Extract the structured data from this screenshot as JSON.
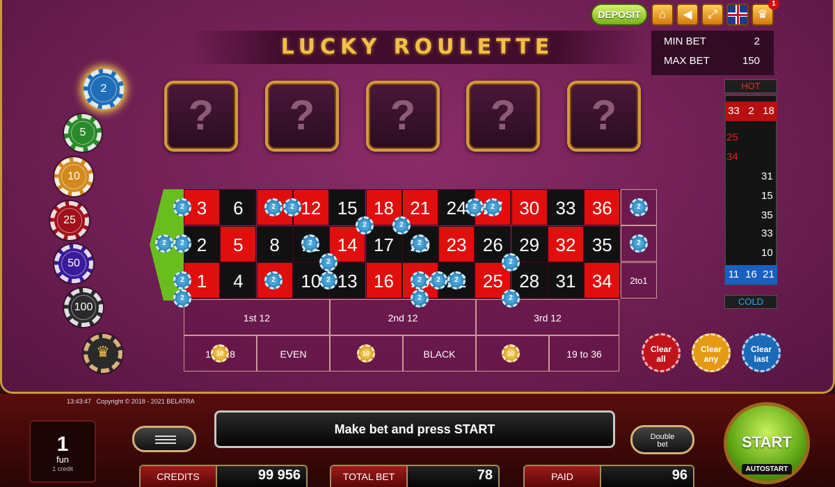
{
  "header": {
    "title": "LUCKY ROULETTE",
    "deposit_label": "DEPOSIT",
    "trophy_badge": "1",
    "icons": [
      "home-icon",
      "sound-icon",
      "fullscreen-icon",
      "uk-flag-icon",
      "trophy-icon"
    ]
  },
  "limits": {
    "min_label": "MIN BET",
    "min_value": "2",
    "max_label": "MAX BET",
    "max_value": "150"
  },
  "mystery_boxes": [
    "?",
    "?",
    "?",
    "?",
    "?"
  ],
  "chips": [
    {
      "value": "2",
      "color": "#1e6fb8",
      "selected": true
    },
    {
      "value": "5",
      "color": "#2a8a2a"
    },
    {
      "value": "10",
      "color": "#d28a1e"
    },
    {
      "value": "25",
      "color": "#a3101a"
    },
    {
      "value": "50",
      "color": "#3a1a9a"
    },
    {
      "value": "100",
      "color": "#2a2a2a"
    }
  ],
  "table": {
    "rows": [
      [
        "3",
        "6",
        "9",
        "12",
        "15",
        "18",
        "21",
        "24",
        "27",
        "30",
        "33",
        "36"
      ],
      [
        "2",
        "5",
        "8",
        "11",
        "14",
        "17",
        "20",
        "23",
        "26",
        "29",
        "32",
        "35"
      ],
      [
        "1",
        "4",
        "7",
        "10",
        "13",
        "16",
        "19",
        "22",
        "25",
        "28",
        "31",
        "34"
      ]
    ],
    "red_numbers": [
      1,
      3,
      5,
      7,
      9,
      12,
      14,
      16,
      18,
      19,
      21,
      23,
      25,
      27,
      30,
      32,
      34,
      36
    ],
    "column_bet_label": "2to1",
    "dozens": [
      "1st 12",
      "2nd 12",
      "3rd 12"
    ],
    "outside": [
      "1 to 18",
      "EVEN",
      "",
      "BLACK",
      "",
      "19 to 36"
    ],
    "chip_label_small": "2",
    "chip_label_big": "10"
  },
  "hot_cold": {
    "hot_label": "HOT",
    "cold_label": "COLD",
    "hot": [
      "33",
      "2",
      "18"
    ],
    "cold": [
      "11",
      "16",
      "21"
    ],
    "history": [
      {
        "n": "25",
        "color": "red"
      },
      {
        "n": "34",
        "color": "red"
      },
      {
        "n": "31",
        "color": "black"
      },
      {
        "n": "15",
        "color": "black"
      },
      {
        "n": "35",
        "color": "black"
      },
      {
        "n": "33",
        "color": "black"
      },
      {
        "n": "10",
        "color": "black"
      }
    ]
  },
  "clear_buttons": [
    {
      "l1": "Clear",
      "l2": "all",
      "color": "#c0141a"
    },
    {
      "l1": "Clear",
      "l2": "any",
      "color": "#e59a12"
    },
    {
      "l1": "Clear",
      "l2": "last",
      "color": "#1a6ab8"
    }
  ],
  "footer": {
    "time": "13:43:47",
    "copyright": "Copyright © 2018 - 2021  BELATRA",
    "credit_value": "1",
    "credit_mode": "fun",
    "credit_note": "1 credit",
    "message": "Make bet and press START",
    "double_l1": "Double",
    "double_l2": "bet",
    "start_label": "START",
    "autostart_label": "AUTOSTART",
    "credits_label": "CREDITS",
    "credits_value": "99 956",
    "total_bet_label": "TOTAL BET",
    "total_bet_value": "78",
    "paid_label": "PAID",
    "paid_value": "96"
  }
}
